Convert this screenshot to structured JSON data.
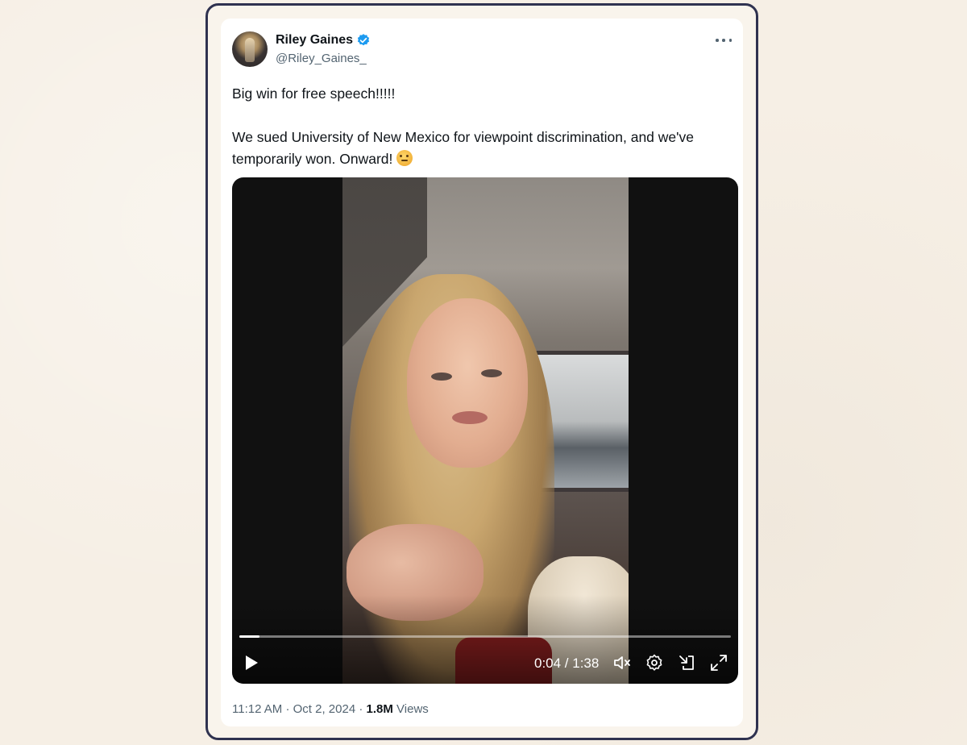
{
  "author": {
    "display_name": "Riley Gaines",
    "handle": "@Riley_Gaines_",
    "verified": true
  },
  "tweet": {
    "paragraph_1": "Big win for free speech!!!!!",
    "paragraph_2": "We sued University of New Mexico for viewpoint discrimination, and we've temporarily won. Onward!",
    "emoji": "saluting-face-emoji"
  },
  "video": {
    "time_display": "0:04 / 1:38",
    "progress_fraction": 0.041
  },
  "meta": {
    "time": "11:12 AM",
    "separator": "·",
    "date": "Oct 2, 2024",
    "views_count": "1.8M",
    "views_label": "Views"
  },
  "colors": {
    "verified_badge": "#1d9bf0",
    "frame_border": "#2f3250",
    "text_secondary": "#536471"
  },
  "icons": [
    "more-icon",
    "verified-badge-icon",
    "play-icon",
    "volume-icon",
    "settings-icon",
    "pop-out-icon",
    "fullscreen-icon"
  ]
}
